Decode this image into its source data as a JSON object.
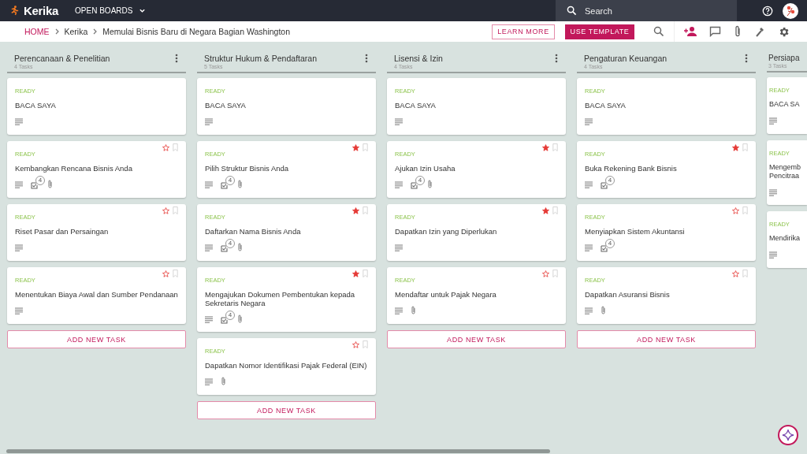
{
  "app": {
    "logo": "Kerika",
    "menu": "OPEN BOARDS",
    "search": {
      "placeholder": "Search"
    }
  },
  "breadcrumb": [
    "HOME",
    "Kerika",
    "Memulai Bisnis Baru di Negara Bagian Washington"
  ],
  "actions": {
    "learn_more": "LEARN MORE",
    "use_template": "USE TEMPLATE"
  },
  "columns": [
    {
      "title": "Perencanaan & Penelitian",
      "count": "4 Tasks",
      "add_task": "ADD NEW TASK",
      "cards": [
        {
          "status": "READY",
          "title": "BACA SAYA",
          "badges": [
            {
              "kind": "description"
            }
          ]
        },
        {
          "status": "READY",
          "title": "Kembangkan Rencana Bisnis Anda",
          "starred": false,
          "badges": [
            {
              "kind": "description"
            },
            {
              "kind": "checklist",
              "count": "4"
            },
            {
              "kind": "attachment"
            }
          ]
        },
        {
          "status": "READY",
          "title": "Riset Pasar dan Persaingan",
          "starred": false,
          "badges": [
            {
              "kind": "description"
            }
          ]
        },
        {
          "status": "READY",
          "title": "Menentukan Biaya Awal dan Sumber Pendanaan",
          "starred": false,
          "badges": [
            {
              "kind": "description"
            }
          ]
        }
      ]
    },
    {
      "title": "Struktur Hukum & Pendaftaran",
      "count": "5 Tasks",
      "add_task": "ADD NEW TASK",
      "cards": [
        {
          "status": "READY",
          "title": "BACA SAYA",
          "badges": [
            {
              "kind": "description"
            }
          ]
        },
        {
          "status": "READY",
          "title": "Pilih Struktur Bisnis Anda",
          "starred": true,
          "badges": [
            {
              "kind": "description"
            },
            {
              "kind": "checklist",
              "count": "4"
            },
            {
              "kind": "attachment"
            }
          ]
        },
        {
          "status": "READY",
          "title": "Daftarkan Nama Bisnis Anda",
          "starred": true,
          "badges": [
            {
              "kind": "description"
            },
            {
              "kind": "checklist",
              "count": "4"
            },
            {
              "kind": "attachment"
            }
          ]
        },
        {
          "status": "READY",
          "title": "Mengajukan Dokumen Pembentukan kepada Sekretaris Negara",
          "starred": true,
          "badges": [
            {
              "kind": "description"
            },
            {
              "kind": "checklist",
              "count": "4"
            },
            {
              "kind": "attachment"
            }
          ]
        },
        {
          "status": "READY",
          "title": "Dapatkan Nomor Identifikasi Pajak Federal (EIN)",
          "starred": false,
          "badges": [
            {
              "kind": "description"
            },
            {
              "kind": "attachment"
            }
          ]
        }
      ]
    },
    {
      "title": "Lisensi & Izin",
      "count": "4 Tasks",
      "add_task": "ADD NEW TASK",
      "cards": [
        {
          "status": "READY",
          "title": "BACA SAYA",
          "badges": [
            {
              "kind": "description"
            }
          ]
        },
        {
          "status": "READY",
          "title": "Ajukan Izin Usaha",
          "starred": true,
          "badges": [
            {
              "kind": "description"
            },
            {
              "kind": "checklist",
              "count": "4"
            },
            {
              "kind": "attachment"
            }
          ]
        },
        {
          "status": "READY",
          "title": "Dapatkan Izin yang Diperlukan",
          "starred": true,
          "badges": [
            {
              "kind": "description"
            }
          ]
        },
        {
          "status": "READY",
          "title": "Mendaftar untuk Pajak Negara",
          "starred": false,
          "badges": [
            {
              "kind": "description"
            },
            {
              "kind": "attachment"
            }
          ]
        }
      ]
    },
    {
      "title": "Pengaturan Keuangan",
      "count": "4 Tasks",
      "add_task": "ADD NEW TASK",
      "cards": [
        {
          "status": "READY",
          "title": "BACA SAYA",
          "badges": [
            {
              "kind": "description"
            }
          ]
        },
        {
          "status": "READY",
          "title": "Buka Rekening Bank Bisnis",
          "starred": true,
          "badges": [
            {
              "kind": "description"
            },
            {
              "kind": "checklist",
              "count": "4"
            }
          ]
        },
        {
          "status": "READY",
          "title": "Menyiapkan Sistem Akuntansi",
          "starred": false,
          "badges": [
            {
              "kind": "description"
            },
            {
              "kind": "checklist",
              "count": "4"
            }
          ]
        },
        {
          "status": "READY",
          "title": "Dapatkan Asuransi Bisnis",
          "starred": false,
          "badges": [
            {
              "kind": "description"
            },
            {
              "kind": "attachment"
            }
          ]
        }
      ]
    },
    {
      "title": "Persiapa",
      "count": "3 Tasks",
      "cards": [
        {
          "status": "READY",
          "title": "BACA SA",
          "badges": [
            {
              "kind": "description"
            }
          ]
        },
        {
          "status": "READY",
          "title": "Mengemb\nPencitraa",
          "badges": [
            {
              "kind": "description"
            }
          ]
        },
        {
          "status": "READY",
          "title": "Mendirika",
          "badges": [
            {
              "kind": "description"
            }
          ]
        }
      ]
    }
  ]
}
